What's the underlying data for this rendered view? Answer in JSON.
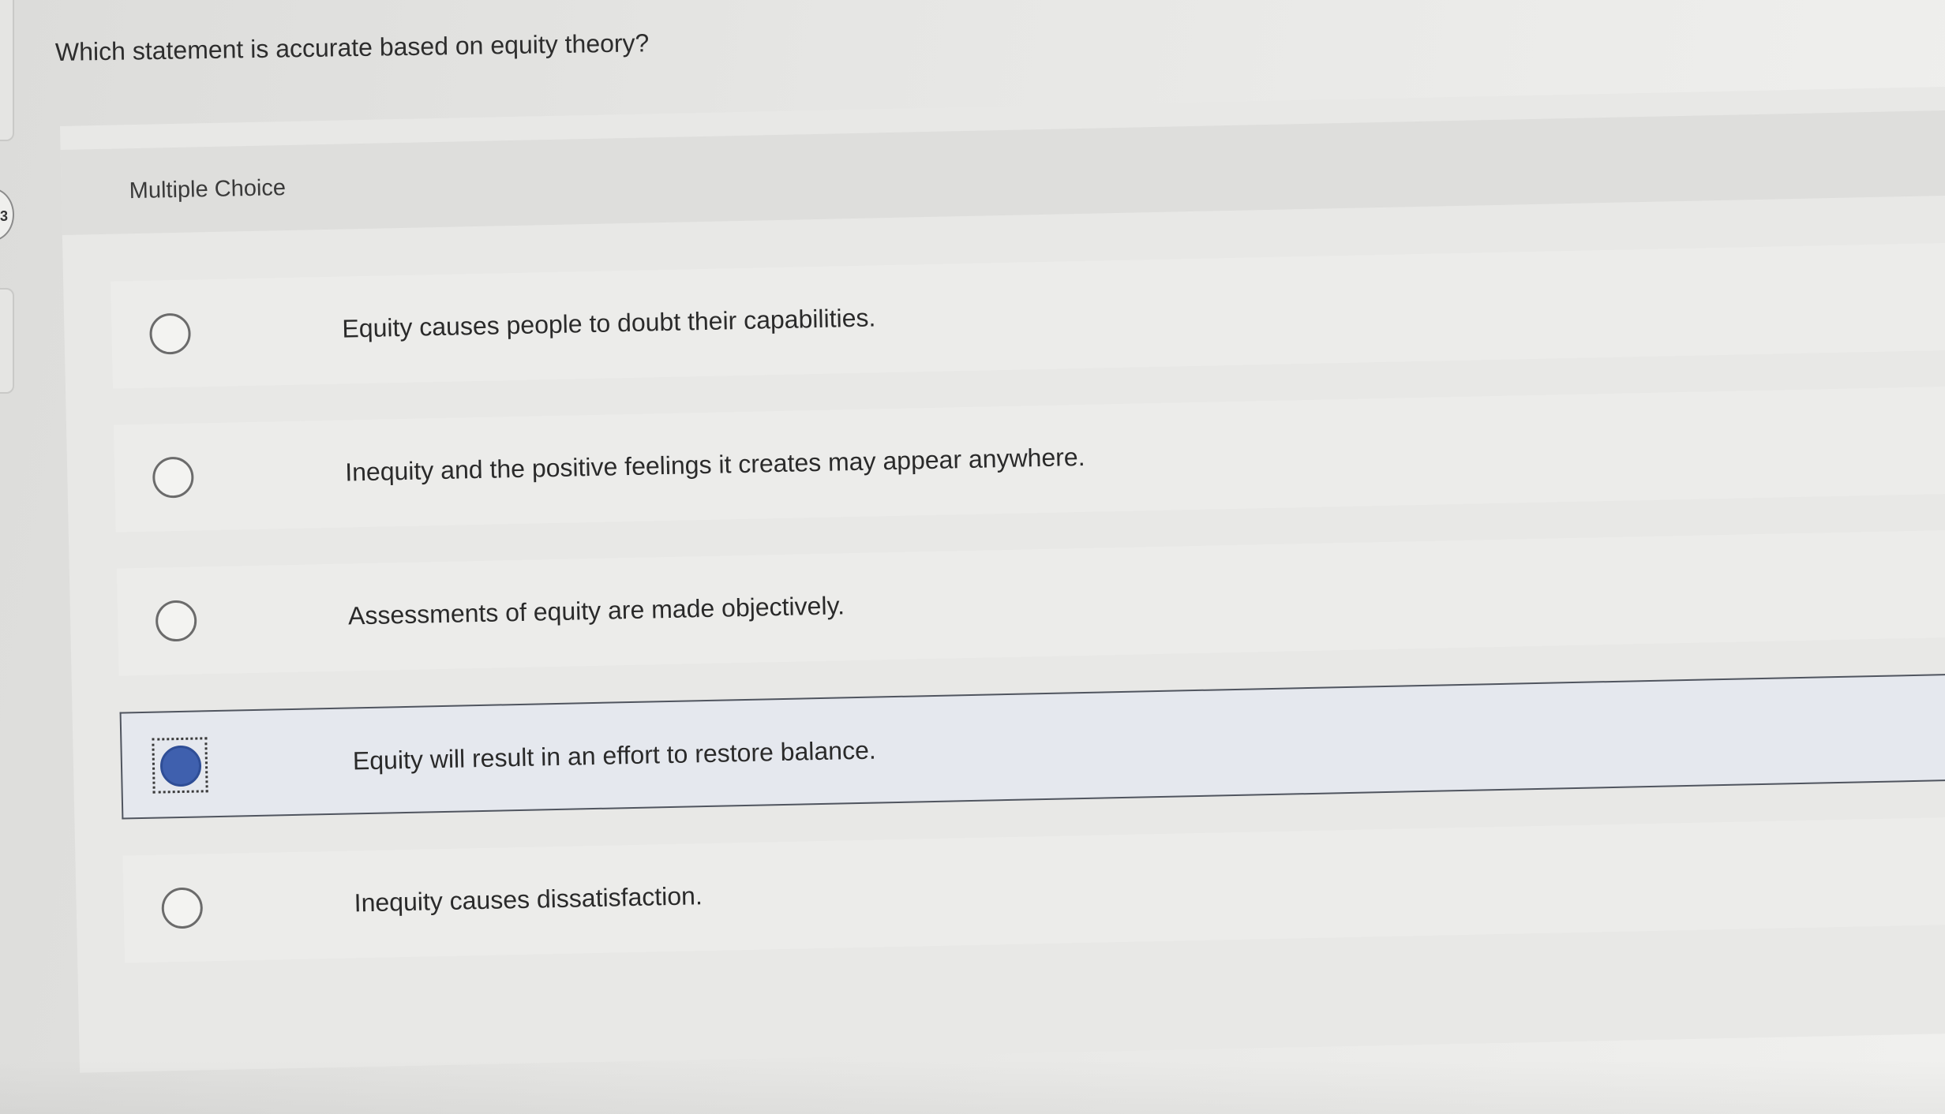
{
  "question": {
    "number": "3",
    "text": "Which statement is accurate based on equity theory?"
  },
  "card": {
    "header_label": "Multiple Choice"
  },
  "options": [
    {
      "label": "Equity causes people to doubt their capabilities.",
      "selected": false
    },
    {
      "label": "Inequity and the positive feelings it creates may appear anywhere.",
      "selected": false
    },
    {
      "label": "Assessments of equity are made objectively.",
      "selected": false
    },
    {
      "label": "Equity will result in an effort to restore balance.",
      "selected": true
    },
    {
      "label": "Inequity causes dissatisfaction.",
      "selected": false
    }
  ],
  "colors": {
    "selected_radio": "#3f60ae",
    "selected_border": "#50555f",
    "background": "#e6e6e4"
  }
}
